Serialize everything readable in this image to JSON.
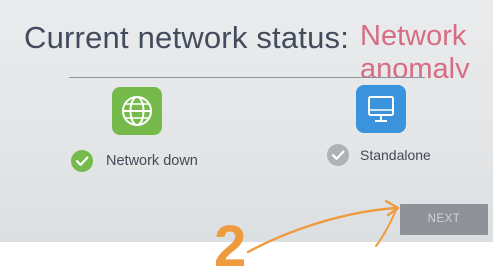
{
  "status": {
    "title": "Current network status:",
    "value": "Network anomaly"
  },
  "modes": [
    {
      "label": "Network down",
      "icon": "globe-icon",
      "selected": true,
      "color": "#76ba4c"
    },
    {
      "label": "Standalone",
      "icon": "monitor-icon",
      "selected": false,
      "color": "#3a93dc"
    }
  ],
  "next_button": {
    "label": "NEXT"
  },
  "annotation": {
    "step": "2",
    "color": "#ef9a3c"
  }
}
